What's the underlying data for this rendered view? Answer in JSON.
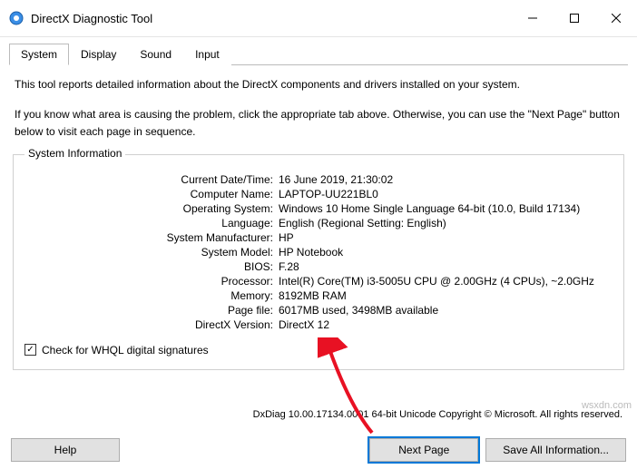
{
  "window": {
    "title": "DirectX Diagnostic Tool"
  },
  "tabs": [
    "System",
    "Display",
    "Sound",
    "Input"
  ],
  "desc": {
    "p1": "This tool reports detailed information about the DirectX components and drivers installed on your system.",
    "p2": "If you know what area is causing the problem, click the appropriate tab above.  Otherwise, you can use the \"Next Page\" button below to visit each page in sequence."
  },
  "group": {
    "title": "System Information"
  },
  "info": {
    "dateLbl": "Current Date/Time:",
    "dateVal": "16 June 2019, 21:30:02",
    "compLbl": "Computer Name:",
    "compVal": "LAPTOP-UU221BL0",
    "osLbl": "Operating System:",
    "osVal": "Windows 10 Home Single Language 64-bit (10.0, Build 17134)",
    "langLbl": "Language:",
    "langVal": "English (Regional Setting: English)",
    "manLbl": "System Manufacturer:",
    "manVal": "HP",
    "modelLbl": "System Model:",
    "modelVal": "HP Notebook",
    "biosLbl": "BIOS:",
    "biosVal": "F.28",
    "procLbl": "Processor:",
    "procVal": "Intel(R) Core(TM) i3-5005U CPU @ 2.00GHz (4 CPUs), ~2.0GHz",
    "memLbl": "Memory:",
    "memVal": "8192MB RAM",
    "pageLbl": "Page file:",
    "pageVal": "6017MB used, 3498MB available",
    "dxLbl": "DirectX Version:",
    "dxVal": "DirectX 12"
  },
  "whql": {
    "label": "Check for WHQL digital signatures"
  },
  "status": "DxDiag 10.00.17134.0001 64-bit Unicode   Copyright © Microsoft. All rights reserved.",
  "buttons": {
    "help": "Help",
    "next": "Next Page",
    "save": "Save All Information..."
  },
  "watermark": "wsxdn.com"
}
